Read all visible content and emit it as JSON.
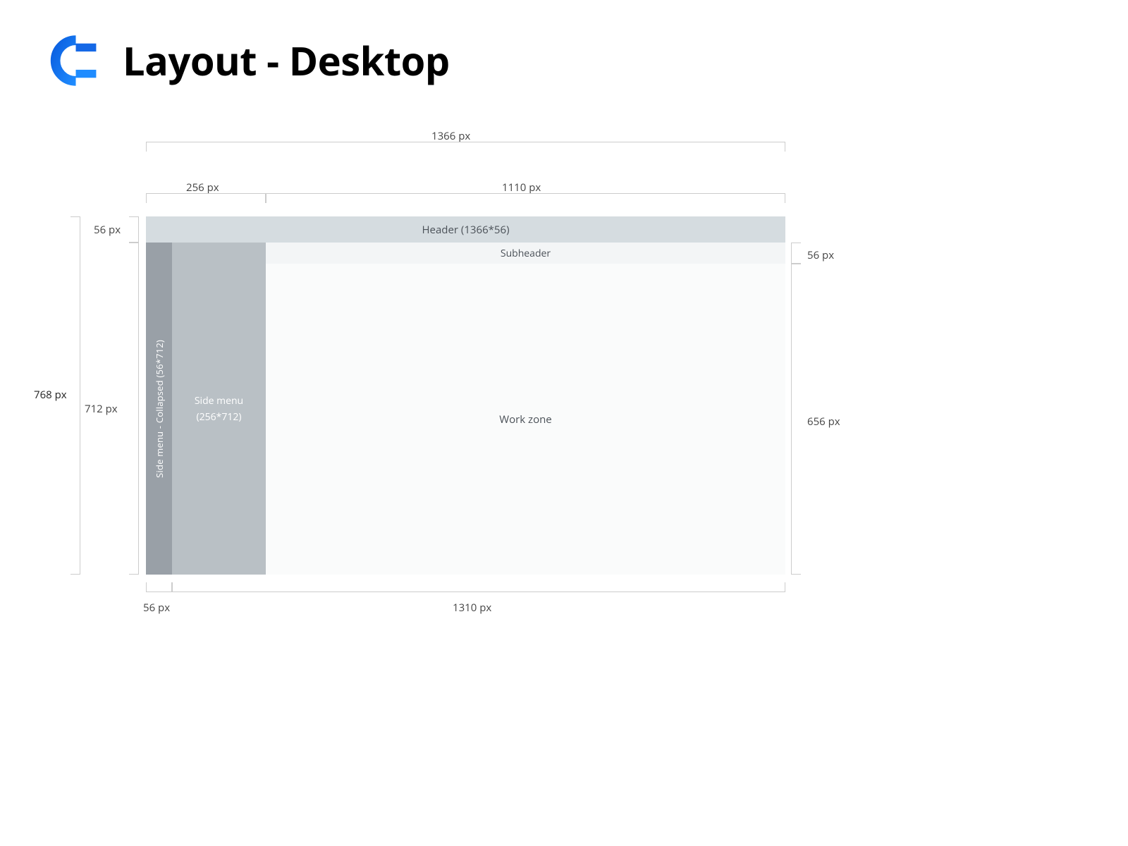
{
  "title": "Layout - Desktop",
  "dimensions": {
    "total_width": "1366 px",
    "total_height": "768 px",
    "side_menu_width": "256 px",
    "work_area_width": "1110 px",
    "header_height": "56 px",
    "body_height": "712 px",
    "collapsed_width": "56 px",
    "expanded_body_width": "1310 px",
    "subheader_height_right": "56 px",
    "workzone_height": "656 px"
  },
  "regions": {
    "header": "Header (1366*56)",
    "subheader": "Subheader",
    "side_collapsed": "Side menu - Collapsed (56*712)",
    "side_menu_line1": "Side menu",
    "side_menu_line2": "(256*712)",
    "workzone": "Work zone"
  }
}
